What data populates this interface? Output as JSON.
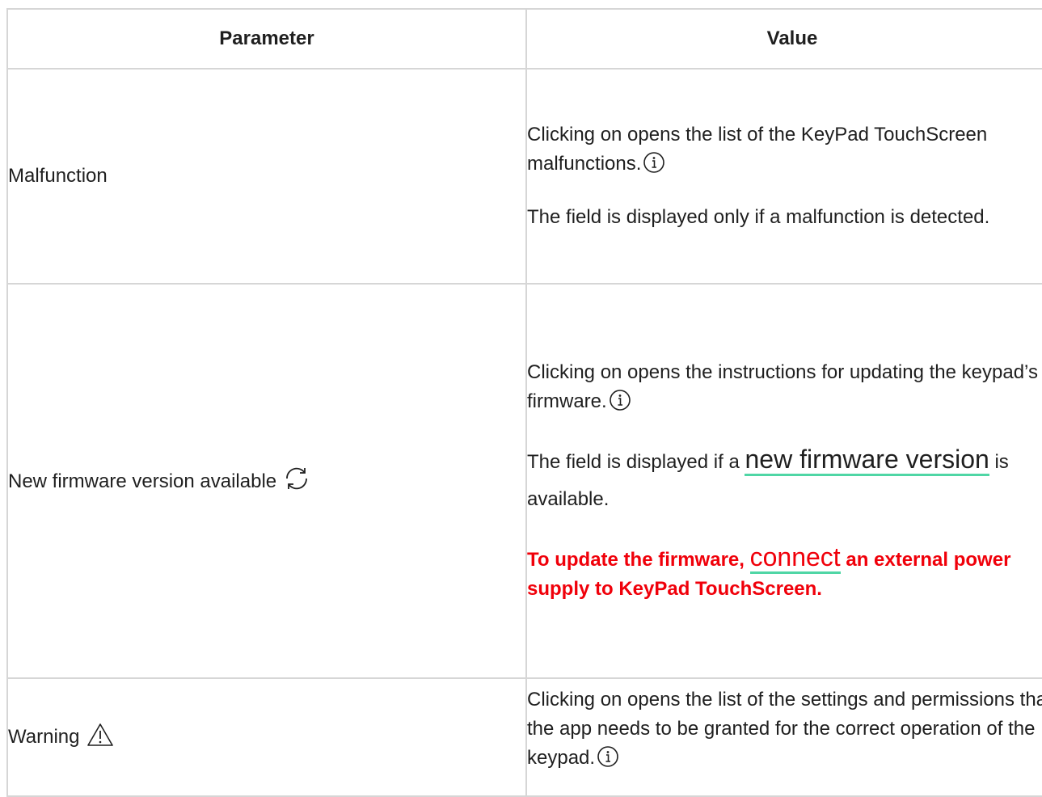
{
  "table": {
    "headers": {
      "parameter": "Parameter",
      "value": "Value"
    },
    "rows": [
      {
        "parameter": "Malfunction",
        "value_p1": "Clicking on opens the list of the KeyPad TouchScreen malfunctions.",
        "value_p2": "The field is displayed only if a malfunction is detected."
      },
      {
        "parameter": "New firmware version available",
        "value_p1": "Clicking on opens the instructions for updating the keypad’s firmware.",
        "value_p2_before": "The field is displayed if a ",
        "value_p2_link": "new firmware version",
        "value_p2_after": " is available.",
        "value_p3_before": "To update the firmware, ",
        "value_p3_link": "connect",
        "value_p3_after": " an external power supply to KeyPad TouchScreen."
      },
      {
        "parameter": "Warning",
        "value_p1": "Clicking on opens the list of the settings and permissions that the app needs to be granted for the correct operation of the keypad."
      }
    ]
  },
  "colors": {
    "link_underline": "#4fd6a5",
    "warning_text": "#f0000a",
    "border": "#d6d6d6"
  },
  "icons": [
    "info-icon",
    "refresh-icon",
    "warning-triangle-icon"
  ]
}
